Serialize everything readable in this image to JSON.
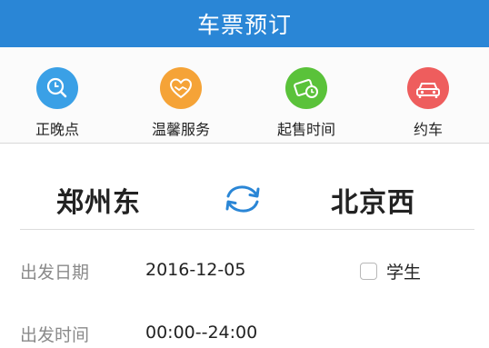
{
  "header": {
    "title": "车票预订"
  },
  "shortcuts": [
    {
      "label": "正晚点",
      "icon": "clock-search-icon",
      "color": "#3aa0e6"
    },
    {
      "label": "温馨服务",
      "icon": "handshake-heart-icon",
      "color": "#f5a337"
    },
    {
      "label": "起售时间",
      "icon": "ticket-clock-icon",
      "color": "#5ac23a"
    },
    {
      "label": "约车",
      "icon": "car-icon",
      "color": "#ee5d5d"
    }
  ],
  "route": {
    "from": "郑州东",
    "to": "北京西",
    "swap_icon": "swap-arrows-icon"
  },
  "form": {
    "date_label": "出发日期",
    "date_value": "2016-12-05",
    "student_label": "学生",
    "student_checked": false,
    "time_label": "出发时间",
    "time_value": "00:00--24:00"
  },
  "colors": {
    "header": "#2a86d6",
    "accent": "#2a86d6"
  }
}
